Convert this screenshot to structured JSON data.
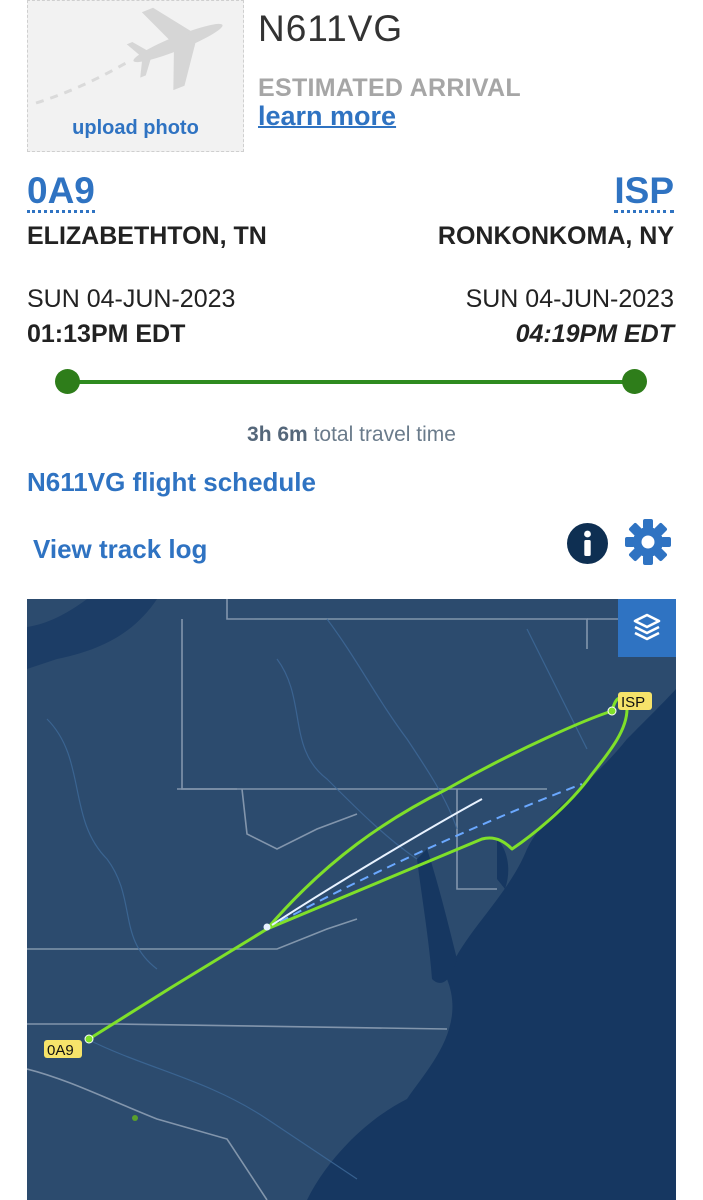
{
  "aircraft": {
    "tail_number": "N611VG",
    "upload_photo_label": "upload photo",
    "status": "ESTIMATED ARRIVAL",
    "learn_more_label": "learn more"
  },
  "origin": {
    "code": "0A9",
    "city": "ELIZABETHTON, TN",
    "date": "SUN 04-JUN-2023",
    "time": "01:13PM EDT"
  },
  "destination": {
    "code": "ISP",
    "city": "RONKONKOMA, NY",
    "date": "SUN 04-JUN-2023",
    "time": "04:19PM EDT"
  },
  "progress": {
    "fraction_complete": 1.0
  },
  "travel": {
    "duration": "3h 6m",
    "suffix": "total travel time"
  },
  "links": {
    "schedule": "N611VG flight schedule",
    "track_log": "View track log"
  },
  "icons": {
    "info": "info-icon",
    "settings": "gear-icon",
    "layers": "layers-icon",
    "placeholder": "airplane-icon"
  },
  "map": {
    "origin_label": "0A9",
    "destination_label": "ISP"
  },
  "colors": {
    "link_blue": "#2f73c2",
    "progress_green": "#2e8b1f",
    "flight_track": "#7fe02a",
    "map_land": "#2c4b6e",
    "map_water": "#163761"
  }
}
